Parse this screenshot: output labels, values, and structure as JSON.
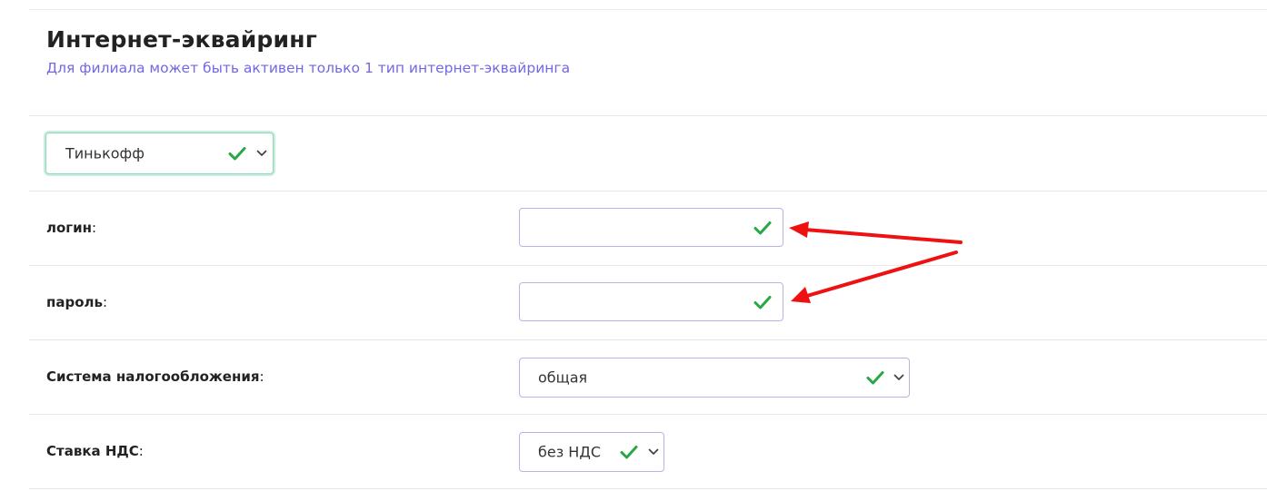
{
  "section": {
    "title": "Интернет-эквайринг",
    "subtitle": "Для филиала может быть активен только 1 тип интернет-эквайринга"
  },
  "bank_select": {
    "selected": "Тинькофф"
  },
  "fields": {
    "login": {
      "label": "логин",
      "colon": ":",
      "value": ""
    },
    "password": {
      "label": "пароль",
      "colon": ":",
      "value": ""
    },
    "tax_system": {
      "label": "Система налогообложения",
      "colon": ":",
      "selected": "общая"
    },
    "vat_rate": {
      "label": "Ставка НДС",
      "colon": ":",
      "selected": "без НДС"
    }
  },
  "icons": {
    "valid": "check-icon",
    "dropdown": "chevron-down-icon",
    "annotation": "red-arrow-icon"
  },
  "colors": {
    "accent": "#7367e6",
    "valid_check": "#28a745",
    "annotation_arrow": "#ee1111",
    "input_border": "#b9b4e8"
  }
}
